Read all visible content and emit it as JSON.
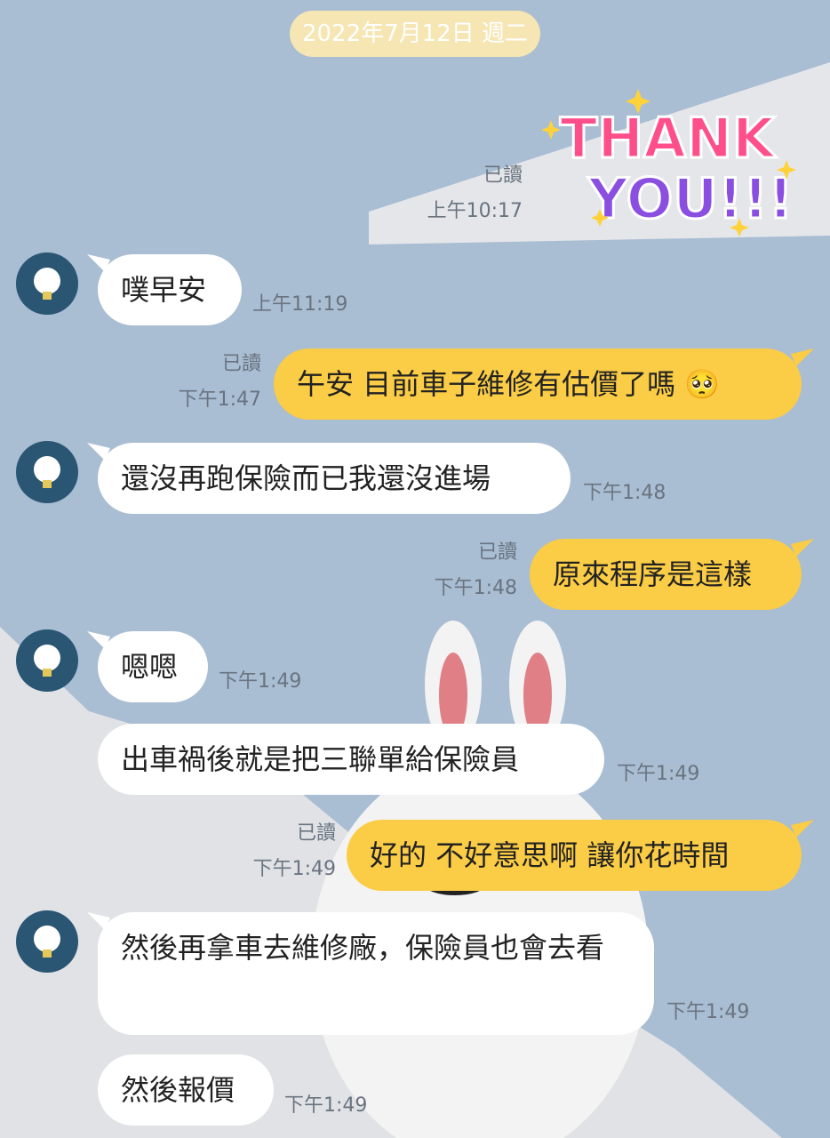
{
  "date_label": "2022年7月12日 週二",
  "sticker": {
    "line1": "THANK",
    "line2": "YOU!!!",
    "read": "已讀",
    "time": "上午10:17"
  },
  "messages": [
    {
      "text": "噗早安",
      "time": "上午11:19"
    },
    {
      "text": "午安 目前車子維修有估價了嗎 🥺",
      "read": "已讀",
      "time": "下午1:47"
    },
    {
      "text": "還沒再跑保險而已我還沒進場",
      "time": "下午1:48"
    },
    {
      "text": "原來程序是這樣",
      "read": "已讀",
      "time": "下午1:48"
    },
    {
      "text": "嗯嗯",
      "time": "下午1:49"
    },
    {
      "text": "出車禍後就是把三聯單給保險員",
      "time": "下午1:49"
    },
    {
      "text": "好的 不好意思啊 讓你花時間",
      "read": "已讀",
      "time": "下午1:49"
    },
    {
      "text": "然後再拿車去維修廠，保險員也會去看",
      "time": "下午1:49"
    },
    {
      "text": "然後報價",
      "time": "下午1:49"
    }
  ],
  "colors": {
    "background": "#a9bdd3",
    "outgoing": "#fbcc45",
    "incoming": "#ffffff",
    "avatar": "#2a5674"
  }
}
